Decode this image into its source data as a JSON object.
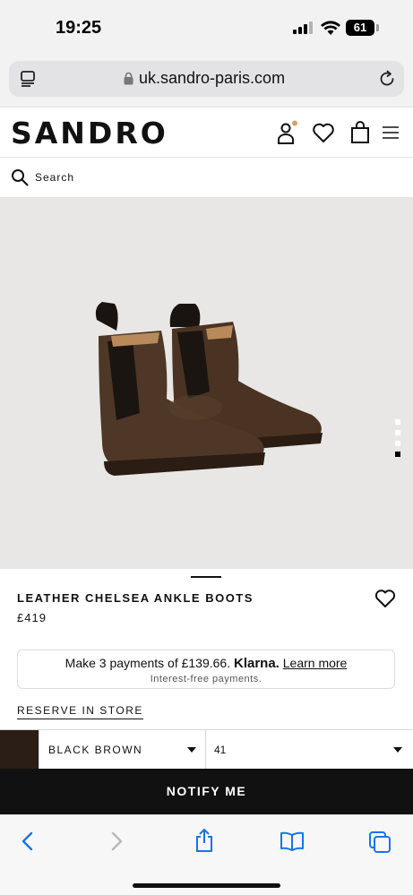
{
  "status_bar": {
    "time": "19:25",
    "battery": "61"
  },
  "browser": {
    "url": "uk.sandro-paris.com"
  },
  "header": {
    "logo": "SANDRO"
  },
  "search": {
    "label": "Search"
  },
  "product": {
    "name": "LEATHER CHELSEA ANKLE BOOTS",
    "price": "£419",
    "image_count": 4,
    "active_image": 4
  },
  "klarna": {
    "text": "Make 3 payments of £139.66.",
    "brand": "Klarna.",
    "link": "Learn more",
    "subtext": "Interest-free payments."
  },
  "reserve_link": "RESERVE IN STORE",
  "selectors": {
    "color_value": "BLACK BROWN",
    "swatch_color": "#2a1e17",
    "size_value": "41"
  },
  "cta": {
    "label": "NOTIFY ME"
  },
  "colors": {
    "accent_dot": "#d9a068",
    "cta_bg": "#111111",
    "gallery_bg": "#e8e7e6"
  }
}
